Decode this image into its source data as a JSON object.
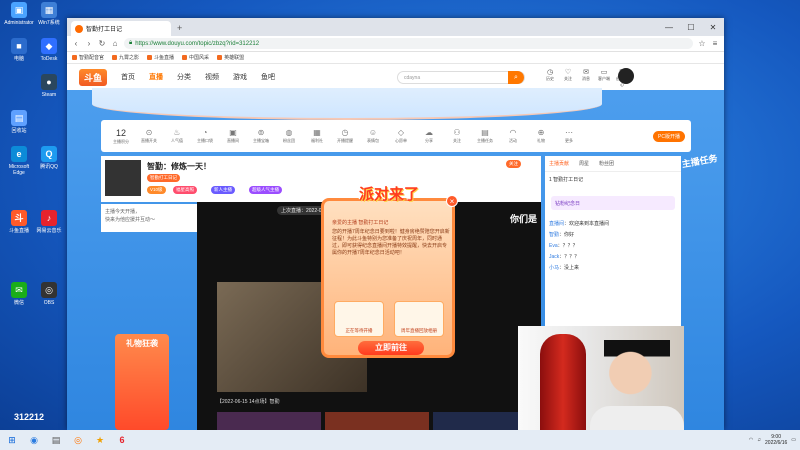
{
  "desktop": {
    "icons": [
      {
        "label": "Administrator",
        "color": "#4aa3ff",
        "glyph": "▣"
      },
      {
        "label": "Win7系统",
        "color": "#3e7fd6",
        "glyph": "▦"
      },
      {
        "label": "电脑",
        "color": "#2b6bcc",
        "glyph": "■"
      },
      {
        "label": "ToDesk",
        "color": "#2f6fff",
        "glyph": "◆"
      },
      {
        "label": "Steam",
        "color": "#2a475e",
        "glyph": "●"
      },
      {
        "label": "回收站",
        "color": "#5ea0ff",
        "glyph": "▤"
      },
      {
        "label": "Microsoft Edge",
        "color": "#0c8bd8",
        "glyph": "e"
      },
      {
        "label": "腾讯QQ",
        "color": "#1d9bf0",
        "glyph": "Q"
      },
      {
        "label": "斗鱼直播",
        "color": "#ff5a2a",
        "glyph": "斗"
      },
      {
        "label": "网易云音乐",
        "color": "#e6232d",
        "glyph": "♪"
      },
      {
        "label": "微信",
        "color": "#1aad19",
        "glyph": "✉"
      },
      {
        "label": "OBS",
        "color": "#333333",
        "glyph": "◎"
      }
    ]
  },
  "browser": {
    "tab_title": "智勤打工日记",
    "url": "https://www.douyu.com/topic/zbzq?rid=312212",
    "bookmarks": [
      "智勤配音官",
      "九霄之影",
      "斗鱼直播",
      "中国风采",
      "英雄联盟"
    ],
    "minimize": "—",
    "maximize": "☐",
    "close": "✕"
  },
  "site": {
    "logo": "斗鱼",
    "nav": [
      "首页",
      "直播",
      "分类",
      "视频",
      "游戏",
      "鱼吧"
    ],
    "active_nav": "直播",
    "search_placeholder": "cdayna",
    "header_icons": [
      "历史",
      "关注",
      "消息",
      "客户端",
      "创作中心"
    ],
    "pc_button": "PC版开播",
    "tools": [
      {
        "count": "12",
        "label": "主播积分"
      },
      {
        "label": "直播开关"
      },
      {
        "label": "人气值"
      },
      {
        "label": "主播口袋"
      },
      {
        "label": "直播间"
      },
      {
        "label": "主播宝箱"
      },
      {
        "label": "粉丝团"
      },
      {
        "label": "福利社"
      },
      {
        "label": "开播提醒"
      },
      {
        "label": "表情包"
      },
      {
        "label": "心愿单"
      },
      {
        "label": "分享"
      },
      {
        "label": "关注"
      },
      {
        "label": "主播任务"
      },
      {
        "label": "活动"
      },
      {
        "label": "礼物"
      },
      {
        "label": "更多"
      }
    ]
  },
  "anchor": {
    "title": "智勤：修炼一天！",
    "name": "智勤打工日记",
    "follow": "关注",
    "level_tag": "福利",
    "tags": [
      "V10级",
      "福星高照",
      "新人主播",
      "超级人气主播"
    ]
  },
  "notice": "主播今天开播，\n快来为他应援并互动～",
  "video": {
    "time": "上次直播：2022-06-15",
    "thumb_label": "【2022-06-15 14点场】智勤",
    "corner_text": "你们是"
  },
  "popup": {
    "title": "派对来了",
    "greeting": "亲爱的主播 智勤打工日记",
    "body": "您的开播7周年纪念日要到啦！健身房绝赞陪您开启新征程！为此斗鱼特别为您准备了庆祝周年，同时通过，即可获得纪念直播间开播特效提醒，快去开启专属你的开播7周年纪念日活动吧！",
    "card1": "正在等待开播",
    "card2": "周年直播回放相册",
    "go_button": "立即前往",
    "close": "×"
  },
  "rank": {
    "tabs": [
      "主播贡献",
      "周星",
      "粉丝团"
    ],
    "top_line": "1 智勤打工日记",
    "fan_badge": "钻粉纪念日",
    "chats": [
      {
        "name": "直播间",
        "text": "欢迎来到本直播间"
      },
      {
        "name": "智勤",
        "text": "你好"
      },
      {
        "name": "Eva",
        "text": "？？？"
      },
      {
        "name": "Jack",
        "text": "？？？"
      },
      {
        "name": "小马",
        "text": "没上来"
      }
    ]
  },
  "mission_text": "主播任务",
  "gift_side": "礼物狂袭",
  "room_number": "312212",
  "taskbar": {
    "items": [
      "⊞",
      "◉",
      "▤",
      "◎",
      "★",
      "6"
    ],
    "time": "9:00",
    "date": "2022/6/16"
  },
  "colors": {
    "brand": "#ff7300",
    "accent_red": "#ff3b1f",
    "desktop_blue": "#1663c7"
  }
}
